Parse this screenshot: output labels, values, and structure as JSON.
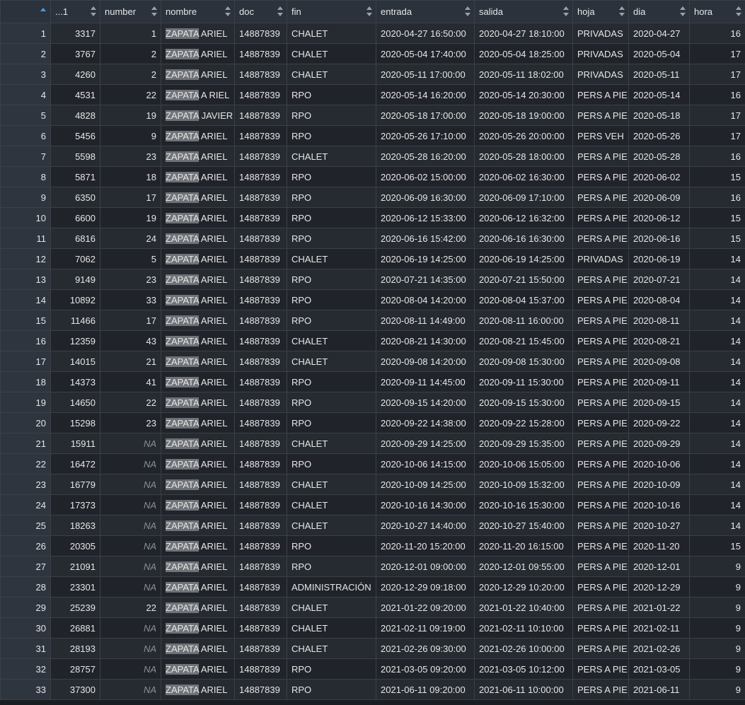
{
  "table": {
    "columns": [
      "",
      "...1",
      "number",
      "nombre",
      "doc",
      "fin",
      "entrada",
      "salida",
      "hoja",
      "dia",
      "hora"
    ],
    "highlight_term": "ZAPATA",
    "rows": [
      {
        "idx": "1",
        "c1": "3317",
        "number": "1",
        "nombre_rest": "ARIEL",
        "doc": "14887839",
        "fin": "CHALET",
        "entrada": "2020-04-27 16:50:00",
        "salida": "2020-04-27 18:10:00",
        "hoja": "PRIVADAS",
        "dia": "2020-04-27",
        "hora": "16"
      },
      {
        "idx": "2",
        "c1": "3767",
        "number": "2",
        "nombre_rest": "ARIEL",
        "doc": "14887839",
        "fin": "CHALET",
        "entrada": "2020-05-04 17:40:00",
        "salida": "2020-05-04 18:25:00",
        "hoja": "PRIVADAS",
        "dia": "2020-05-04",
        "hora": "17"
      },
      {
        "idx": "3",
        "c1": "4260",
        "number": "2",
        "nombre_rest": "ARIEL",
        "doc": "14887839",
        "fin": "CHALET",
        "entrada": "2020-05-11 17:00:00",
        "salida": "2020-05-11 18:02:00",
        "hoja": "PRIVADAS",
        "dia": "2020-05-11",
        "hora": "17"
      },
      {
        "idx": "4",
        "c1": "4531",
        "number": "22",
        "nombre_rest": "A RIEL",
        "doc": "14887839",
        "fin": "RPO",
        "entrada": "2020-05-14 16:20:00",
        "salida": "2020-05-14 20:30:00",
        "hoja": "PERS A PIE",
        "dia": "2020-05-14",
        "hora": "16"
      },
      {
        "idx": "5",
        "c1": "4828",
        "number": "19",
        "nombre_rest": "JAVIER",
        "doc": "14887839",
        "fin": "RPO",
        "entrada": "2020-05-18 17:00:00",
        "salida": "2020-05-18 19:00:00",
        "hoja": "PERS A PIE",
        "dia": "2020-05-18",
        "hora": "17"
      },
      {
        "idx": "6",
        "c1": "5456",
        "number": "9",
        "nombre_rest": "ARIEL",
        "doc": "14887839",
        "fin": "RPO",
        "entrada": "2020-05-26 17:10:00",
        "salida": "2020-05-26 20:00:00",
        "hoja": "PERS VEH",
        "dia": "2020-05-26",
        "hora": "17"
      },
      {
        "idx": "7",
        "c1": "5598",
        "number": "23",
        "nombre_rest": "ARIEL",
        "doc": "14887839",
        "fin": "CHALET",
        "entrada": "2020-05-28 16:20:00",
        "salida": "2020-05-28 18:00:00",
        "hoja": "PERS A PIE",
        "dia": "2020-05-28",
        "hora": "16"
      },
      {
        "idx": "8",
        "c1": "5871",
        "number": "18",
        "nombre_rest": "ARIEL",
        "doc": "14887839",
        "fin": "RPO",
        "entrada": "2020-06-02 15:00:00",
        "salida": "2020-06-02 16:30:00",
        "hoja": "PERS A PIE",
        "dia": "2020-06-02",
        "hora": "15"
      },
      {
        "idx": "9",
        "c1": "6350",
        "number": "17",
        "nombre_rest": "ARIEL",
        "doc": "14887839",
        "fin": "RPO",
        "entrada": "2020-06-09 16:30:00",
        "salida": "2020-06-09 17:10:00",
        "hoja": "PERS A PIE",
        "dia": "2020-06-09",
        "hora": "16"
      },
      {
        "idx": "10",
        "c1": "6600",
        "number": "19",
        "nombre_rest": "ARIEL",
        "doc": "14887839",
        "fin": "RPO",
        "entrada": "2020-06-12 15:33:00",
        "salida": "2020-06-12 16:32:00",
        "hoja": "PERS A PIE",
        "dia": "2020-06-12",
        "hora": "15"
      },
      {
        "idx": "11",
        "c1": "6816",
        "number": "24",
        "nombre_rest": "ARIEL",
        "doc": "14887839",
        "fin": "RPO",
        "entrada": "2020-06-16 15:42:00",
        "salida": "2020-06-16 16:30:00",
        "hoja": "PERS A PIE",
        "dia": "2020-06-16",
        "hora": "15"
      },
      {
        "idx": "12",
        "c1": "7062",
        "number": "5",
        "nombre_rest": "ARIEL",
        "doc": "14887839",
        "fin": "CHALET",
        "entrada": "2020-06-19 14:25:00",
        "salida": "2020-06-19 14:25:00",
        "hoja": "PRIVADAS",
        "dia": "2020-06-19",
        "hora": "14"
      },
      {
        "idx": "13",
        "c1": "9149",
        "number": "23",
        "nombre_rest": "ARIEL",
        "doc": "14887839",
        "fin": "RPO",
        "entrada": "2020-07-21 14:35:00",
        "salida": "2020-07-21 15:50:00",
        "hoja": "PERS A PIE",
        "dia": "2020-07-21",
        "hora": "14"
      },
      {
        "idx": "14",
        "c1": "10892",
        "number": "33",
        "nombre_rest": "ARIEL",
        "doc": "14887839",
        "fin": "RPO",
        "entrada": "2020-08-04 14:20:00",
        "salida": "2020-08-04 15:37:00",
        "hoja": "PERS A PIE",
        "dia": "2020-08-04",
        "hora": "14"
      },
      {
        "idx": "15",
        "c1": "11466",
        "number": "17",
        "nombre_rest": "ARIEL",
        "doc": "14887839",
        "fin": "RPO",
        "entrada": "2020-08-11 14:49:00",
        "salida": "2020-08-11 16:00:00",
        "hoja": "PERS A PIE",
        "dia": "2020-08-11",
        "hora": "14"
      },
      {
        "idx": "16",
        "c1": "12359",
        "number": "43",
        "nombre_rest": "ARIEL",
        "doc": "14887839",
        "fin": "CHALET",
        "entrada": "2020-08-21 14:30:00",
        "salida": "2020-08-21 15:45:00",
        "hoja": "PERS A PIE",
        "dia": "2020-08-21",
        "hora": "14"
      },
      {
        "idx": "17",
        "c1": "14015",
        "number": "21",
        "nombre_rest": "ARIEL",
        "doc": "14887839",
        "fin": "CHALET",
        "entrada": "2020-09-08 14:20:00",
        "salida": "2020-09-08 15:30:00",
        "hoja": "PERS A PIE",
        "dia": "2020-09-08",
        "hora": "14"
      },
      {
        "idx": "18",
        "c1": "14373",
        "number": "41",
        "nombre_rest": "ARIEL",
        "doc": "14887839",
        "fin": "RPO",
        "entrada": "2020-09-11 14:45:00",
        "salida": "2020-09-11 15:30:00",
        "hoja": "PERS A PIE",
        "dia": "2020-09-11",
        "hora": "14"
      },
      {
        "idx": "19",
        "c1": "14650",
        "number": "22",
        "nombre_rest": "ARIEL",
        "doc": "14887839",
        "fin": "RPO",
        "entrada": "2020-09-15 14:20:00",
        "salida": "2020-09-15 15:30:00",
        "hoja": "PERS A PIE",
        "dia": "2020-09-15",
        "hora": "14"
      },
      {
        "idx": "20",
        "c1": "15298",
        "number": "23",
        "nombre_rest": "ARIEL",
        "doc": "14887839",
        "fin": "RPO",
        "entrada": "2020-09-22 14:38:00",
        "salida": "2020-09-22 15:28:00",
        "hoja": "PERS A PIE",
        "dia": "2020-09-22",
        "hora": "14"
      },
      {
        "idx": "21",
        "c1": "15911",
        "number": "NA",
        "nombre_rest": "ARIEL",
        "doc": "14887839",
        "fin": "CHALET",
        "entrada": "2020-09-29 14:25:00",
        "salida": "2020-09-29 15:35:00",
        "hoja": "PERS A PIE",
        "dia": "2020-09-29",
        "hora": "14"
      },
      {
        "idx": "22",
        "c1": "16472",
        "number": "NA",
        "nombre_rest": "ARIEL",
        "doc": "14887839",
        "fin": "RPO",
        "entrada": "2020-10-06 14:15:00",
        "salida": "2020-10-06 15:05:00",
        "hoja": "PERS A PIE",
        "dia": "2020-10-06",
        "hora": "14"
      },
      {
        "idx": "23",
        "c1": "16779",
        "number": "NA",
        "nombre_rest": "ARIEL",
        "doc": "14887839",
        "fin": "CHALET",
        "entrada": "2020-10-09 14:25:00",
        "salida": "2020-10-09 15:32:00",
        "hoja": "PERS A PIE",
        "dia": "2020-10-09",
        "hora": "14"
      },
      {
        "idx": "24",
        "c1": "17373",
        "number": "NA",
        "nombre_rest": "ARIEL",
        "doc": "14887839",
        "fin": "CHALET",
        "entrada": "2020-10-16 14:30:00",
        "salida": "2020-10-16 15:30:00",
        "hoja": "PERS A PIE",
        "dia": "2020-10-16",
        "hora": "14"
      },
      {
        "idx": "25",
        "c1": "18263",
        "number": "NA",
        "nombre_rest": "ARIEL",
        "doc": "14887839",
        "fin": "CHALET",
        "entrada": "2020-10-27 14:40:00",
        "salida": "2020-10-27 15:40:00",
        "hoja": "PERS A PIE",
        "dia": "2020-10-27",
        "hora": "14"
      },
      {
        "idx": "26",
        "c1": "20305",
        "number": "NA",
        "nombre_rest": "ARIEL",
        "doc": "14887839",
        "fin": "RPO",
        "entrada": "2020-11-20 15:20:00",
        "salida": "2020-11-20 16:15:00",
        "hoja": "PERS A PIE",
        "dia": "2020-11-20",
        "hora": "15"
      },
      {
        "idx": "27",
        "c1": "21091",
        "number": "NA",
        "nombre_rest": "ARIEL",
        "doc": "14887839",
        "fin": "RPO",
        "entrada": "2020-12-01 09:00:00",
        "salida": "2020-12-01 09:55:00",
        "hoja": "PERS A PIE",
        "dia": "2020-12-01",
        "hora": "9"
      },
      {
        "idx": "28",
        "c1": "23301",
        "number": "NA",
        "nombre_rest": "ARIEL",
        "doc": "14887839",
        "fin": "ADMINISTRACIÓN",
        "entrada": "2020-12-29 09:18:00",
        "salida": "2020-12-29 10:20:00",
        "hoja": "PERS A PIE",
        "dia": "2020-12-29",
        "hora": "9"
      },
      {
        "idx": "29",
        "c1": "25239",
        "number": "22",
        "nombre_rest": "ARIEL",
        "doc": "14887839",
        "fin": "CHALET",
        "entrada": "2021-01-22 09:20:00",
        "salida": "2021-01-22 10:40:00",
        "hoja": "PERS A PIE",
        "dia": "2021-01-22",
        "hora": "9"
      },
      {
        "idx": "30",
        "c1": "26881",
        "number": "NA",
        "nombre_rest": "ARIEL",
        "doc": "14887839",
        "fin": "CHALET",
        "entrada": "2021-02-11 09:19:00",
        "salida": "2021-02-11 10:10:00",
        "hoja": "PERS A PIE",
        "dia": "2021-02-11",
        "hora": "9"
      },
      {
        "idx": "31",
        "c1": "28193",
        "number": "NA",
        "nombre_rest": "ARIEL",
        "doc": "14887839",
        "fin": "CHALET",
        "entrada": "2021-02-26 09:30:00",
        "salida": "2021-02-26 10:00:00",
        "hoja": "PERS A PIE",
        "dia": "2021-02-26",
        "hora": "9"
      },
      {
        "idx": "32",
        "c1": "28757",
        "number": "NA",
        "nombre_rest": "ARIEL",
        "doc": "14887839",
        "fin": "RPO",
        "entrada": "2021-03-05 09:20:00",
        "salida": "2021-03-05 10:12:00",
        "hoja": "PERS A PIE",
        "dia": "2021-03-05",
        "hora": "9"
      },
      {
        "idx": "33",
        "c1": "37300",
        "number": "NA",
        "nombre_rest": "ARIEL",
        "doc": "14887839",
        "fin": "RPO",
        "entrada": "2021-06-11 09:20:00",
        "salida": "2021-06-11 10:00:00",
        "hoja": "PERS A PIE",
        "dia": "2021-06-11",
        "hora": "9"
      }
    ]
  },
  "colors": {
    "background": "#1f2329",
    "header": "#2b323b",
    "highlight": "#6f7378",
    "sort_active": "#4f9be0",
    "na_text": "#8a8f96"
  }
}
